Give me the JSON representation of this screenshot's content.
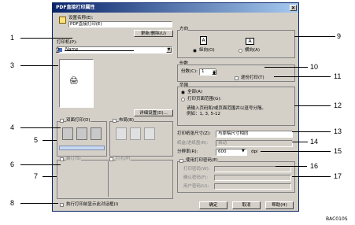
{
  "window": {
    "title": "PDF直接打印属性"
  },
  "preset": {
    "label": "设置名称(E):",
    "value": "PDF直接打印(E)",
    "button": "更新/删除(U)"
  },
  "printer": {
    "label": "打印机(P):",
    "value": "Name"
  },
  "detail_button": "详细设置(D)...",
  "duplex": {
    "label": "双面打印(D)"
  },
  "booklet": {
    "label": "布局(B)"
  },
  "staple": {
    "label": "装订(S)"
  },
  "punch": {
    "label": "打孔(P)"
  },
  "orientation": {
    "group": "方向",
    "portrait": "纵向(O)",
    "landscape": "横向(A)"
  },
  "copies": {
    "group": "份数",
    "label": "份数(C):",
    "value": "1"
  },
  "collate": {
    "label": "逐份打印(T)"
  },
  "range": {
    "group": "范围",
    "all": "全部(A)",
    "pages": "打印页面范围(G):",
    "hint1": "请输入页码和/或页面范围并以逗号分隔。",
    "hint2": "例如：1, 3, 5-12"
  },
  "paper_size": {
    "label": "打印纸张尺寸(Z):",
    "value": "与原稿尺寸相同"
  },
  "tray": {
    "label": "纸盒/进纸盘(R):",
    "value": "自动"
  },
  "resolution": {
    "label": "分辨率(R):",
    "value": "600",
    "unit": "dpi"
  },
  "security": {
    "label": "使用打印密码(E)",
    "pw_label": "打印密码(W):",
    "confirm_label": "确认密码(F):",
    "user_label": "用户密码(U):"
  },
  "bottom_check": {
    "label": "执行打印前显示此对话框(I)"
  },
  "buttons": {
    "ok": "确定",
    "cancel": "取消",
    "help": "帮助(H)"
  },
  "callouts": [
    "1",
    "2",
    "3",
    "4",
    "5",
    "6",
    "7",
    "8",
    "9",
    "10",
    "11",
    "12",
    "13",
    "14",
    "15",
    "16",
    "17"
  ],
  "figure_code": "BAC010S"
}
